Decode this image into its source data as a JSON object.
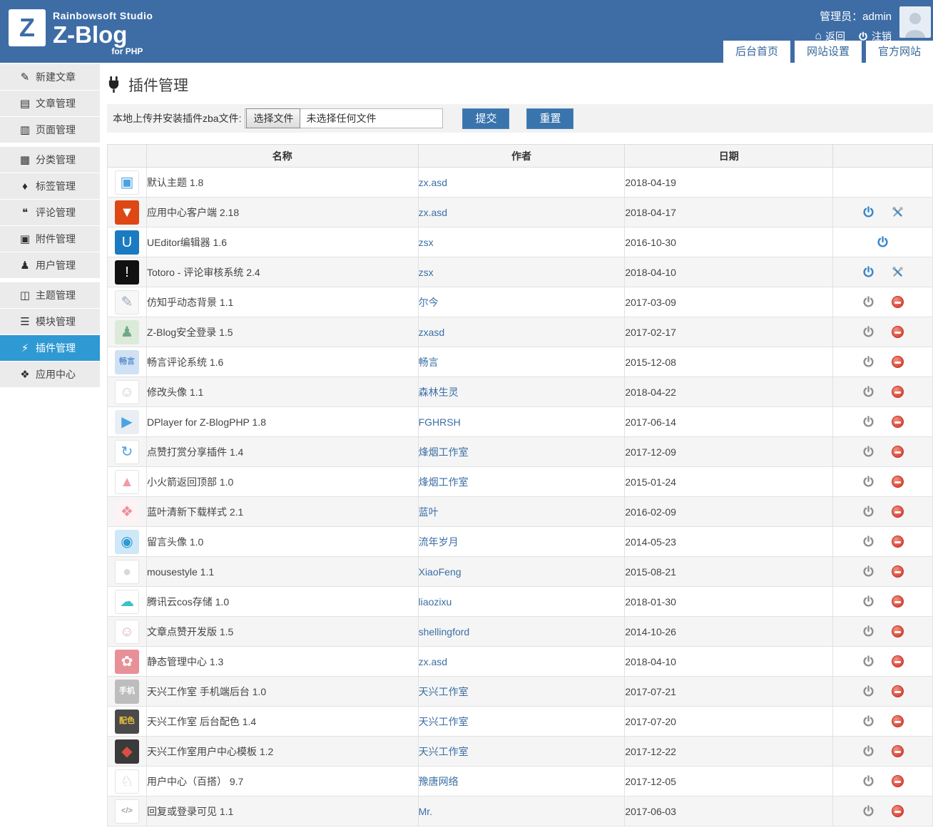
{
  "colors": {
    "header_bg": "#3e6da6",
    "active_sidebar_bg": "#2f99d3",
    "button_bg": "#3a74ad",
    "link": "#3a6ea5",
    "power_on": "#3a87c8",
    "power_off": "#8f8f8f",
    "disable_red": "#dd4b3e"
  },
  "header": {
    "brand": {
      "logo_letter": "Z",
      "studio": "Rainbowsoft Studio",
      "name": "Z-Blog",
      "sub": "for PHP"
    },
    "user": {
      "role_label": "管理员：",
      "username": "admin",
      "back": "返回",
      "logout": "注销"
    },
    "tabs": [
      {
        "label": "后台首页"
      },
      {
        "label": "网站设置"
      },
      {
        "label": "官方网站"
      }
    ]
  },
  "sidebar": {
    "groups": [
      {
        "items": [
          {
            "icon": "pencil",
            "glyph": "✎",
            "label": "新建文章",
            "active": false
          },
          {
            "icon": "document",
            "glyph": "▤",
            "label": "文章管理",
            "active": false
          },
          {
            "icon": "page",
            "glyph": "▥",
            "label": "页面管理",
            "active": false
          }
        ]
      },
      {
        "items": [
          {
            "icon": "folder",
            "glyph": "▦",
            "label": "分类管理",
            "active": false
          },
          {
            "icon": "tag",
            "glyph": "♦",
            "label": "标签管理",
            "active": false
          },
          {
            "icon": "comment",
            "glyph": "❝",
            "label": "评论管理",
            "active": false
          },
          {
            "icon": "attachment",
            "glyph": "▣",
            "label": "附件管理",
            "active": false
          },
          {
            "icon": "user",
            "glyph": "♟",
            "label": "用户管理",
            "active": false
          }
        ]
      },
      {
        "items": [
          {
            "icon": "theme",
            "glyph": "◫",
            "label": "主题管理",
            "active": false
          },
          {
            "icon": "module",
            "glyph": "☰",
            "label": "模块管理",
            "active": false
          },
          {
            "icon": "plugin",
            "glyph": "⚡",
            "label": "插件管理",
            "active": true
          },
          {
            "icon": "appcenter",
            "glyph": "❖",
            "label": "应用中心",
            "active": false
          }
        ]
      }
    ]
  },
  "main": {
    "title": "插件管理",
    "upload": {
      "label": "本地上传并安装插件zba文件:",
      "choose_file": "选择文件",
      "no_file": "未选择任何文件",
      "submit": "提交",
      "reset": "重置"
    },
    "table": {
      "headers": {
        "name": "名称",
        "author": "作者",
        "date": "日期"
      },
      "rows": [
        {
          "icon": {
            "glyph": "▣",
            "fg": "#4aa3e0",
            "bg": "#ffffff",
            "border": true
          },
          "name": "默认主题 1.8",
          "author": "zx.asd",
          "date": "2018-04-19",
          "actions": []
        },
        {
          "icon": {
            "glyph": "▼",
            "fg": "#ffffff",
            "bg": "#dd4814"
          },
          "name": "应用中心客户端 2.18",
          "author": "zx.asd",
          "date": "2018-04-17",
          "actions": [
            "power-on",
            "tools"
          ]
        },
        {
          "icon": {
            "glyph": "U",
            "fg": "#ffffff",
            "bg": "#1a7bc0"
          },
          "name": "UEditor编辑器 1.6",
          "author": "zsx",
          "date": "2016-10-30",
          "actions": [
            "power-on"
          ]
        },
        {
          "icon": {
            "glyph": "!",
            "fg": "#ffffff",
            "bg": "#111111"
          },
          "name": "Totoro - 评论审核系统 2.4",
          "author": "zsx",
          "date": "2018-04-10",
          "actions": [
            "power-on",
            "tools"
          ]
        },
        {
          "icon": {
            "glyph": "✎",
            "fg": "#9aa7b5",
            "bg": "#f7f7f7",
            "border": true
          },
          "name": "仿知乎动态背景 1.1",
          "author": "尔今",
          "date": "2017-03-09",
          "actions": [
            "power-off",
            "ban"
          ]
        },
        {
          "icon": {
            "glyph": "♟",
            "fg": "#6fa885",
            "bg": "#dcead9"
          },
          "name": "Z-Blog安全登录 1.5",
          "author": "zxasd",
          "date": "2017-02-17",
          "actions": [
            "power-off",
            "ban"
          ]
        },
        {
          "icon": {
            "glyph": "畅言",
            "fg": "#5b8fd0",
            "bg": "#cfe1f3",
            "small": true
          },
          "name": "畅言评论系统 1.6",
          "author": "畅言",
          "date": "2015-12-08",
          "actions": [
            "power-off",
            "ban"
          ]
        },
        {
          "icon": {
            "glyph": "☺",
            "fg": "#c9c9c9",
            "bg": "#ffffff",
            "border": true
          },
          "name": "修改头像 1.1",
          "author": "森林生灵",
          "date": "2018-04-22",
          "actions": [
            "power-off",
            "ban"
          ]
        },
        {
          "icon": {
            "glyph": "▶",
            "fg": "#4aa3e0",
            "bg": "#e9eef5"
          },
          "name": "DPlayer for Z-BlogPHP 1.8",
          "author": "FGHRSH",
          "date": "2017-06-14",
          "actions": [
            "power-off",
            "ban"
          ]
        },
        {
          "icon": {
            "glyph": "↻",
            "fg": "#4aa3e0",
            "bg": "#ffffff",
            "border": true
          },
          "name": "点赞打赏分享插件 1.4",
          "author": "烽烟工作室",
          "date": "2017-12-09",
          "actions": [
            "power-off",
            "ban"
          ]
        },
        {
          "icon": {
            "glyph": "▲",
            "fg": "#f29aa8",
            "bg": "#ffffff",
            "border": true
          },
          "name": "小火箭返回顶部 1.0",
          "author": "烽烟工作室",
          "date": "2015-01-24",
          "actions": [
            "power-off",
            "ban"
          ]
        },
        {
          "icon": {
            "glyph": "❖",
            "fg": "#ee8d9a",
            "bg": "#fdf3f4"
          },
          "name": "蓝叶清新下载样式 2.1",
          "author": "蓝叶",
          "date": "2016-02-09",
          "actions": [
            "power-off",
            "ban"
          ]
        },
        {
          "icon": {
            "glyph": "◉",
            "fg": "#2f99d3",
            "bg": "#cfe8f8"
          },
          "name": "留言头像 1.0",
          "author": "流年岁月",
          "date": "2014-05-23",
          "actions": [
            "power-off",
            "ban"
          ]
        },
        {
          "icon": {
            "glyph": "●",
            "fg": "#d9d9d9",
            "bg": "#ffffff",
            "border": true
          },
          "name": "mousestyle 1.1",
          "author": "XiaoFeng",
          "date": "2015-08-21",
          "actions": [
            "power-off",
            "ban"
          ]
        },
        {
          "icon": {
            "glyph": "☁",
            "fg": "#39c2c9",
            "bg": "#ffffff",
            "border": true
          },
          "name": "腾讯云cos存储 1.0",
          "author": "liaozixu",
          "date": "2018-01-30",
          "actions": [
            "power-off",
            "ban"
          ]
        },
        {
          "icon": {
            "glyph": "☺",
            "fg": "#d8b0b0",
            "bg": "#ffffff",
            "border": true
          },
          "name": "文章点赞开发版 1.5",
          "author": "shellingford",
          "date": "2014-10-26",
          "actions": [
            "power-off",
            "ban"
          ]
        },
        {
          "icon": {
            "glyph": "✿",
            "fg": "#ffffff",
            "bg": "#e89098"
          },
          "name": "静态管理中心 1.3",
          "author": "zx.asd",
          "date": "2018-04-10",
          "actions": [
            "power-off",
            "ban"
          ]
        },
        {
          "icon": {
            "glyph": "手机",
            "fg": "#ffffff",
            "bg": "#bdbdbd",
            "small": true
          },
          "name": "天兴工作室 手机端后台 1.0",
          "author": "天兴工作室",
          "date": "2017-07-21",
          "actions": [
            "power-off",
            "ban"
          ]
        },
        {
          "icon": {
            "glyph": "配色",
            "fg": "#e8c33a",
            "bg": "#4a4a4a",
            "small": true
          },
          "name": "天兴工作室 后台配色 1.4",
          "author": "天兴工作室",
          "date": "2017-07-20",
          "actions": [
            "power-off",
            "ban"
          ]
        },
        {
          "icon": {
            "glyph": "◆",
            "fg": "#d94f43",
            "bg": "#3a3a3a"
          },
          "name": "天兴工作室用户中心模板 1.2",
          "author": "天兴工作室",
          "date": "2017-12-22",
          "actions": [
            "power-off",
            "ban"
          ]
        },
        {
          "icon": {
            "glyph": "♘",
            "fg": "#c6c6c6",
            "bg": "#ffffff",
            "border": true
          },
          "name": "用户中心（百搭） 9.7",
          "author": "豫唐网络",
          "date": "2017-12-05",
          "actions": [
            "power-off",
            "ban"
          ]
        },
        {
          "icon": {
            "glyph": "</>",
            "fg": "#9f9f9f",
            "bg": "#ffffff",
            "border": true,
            "small": true
          },
          "name": "回复或登录可见 1.1",
          "author": "Mr.",
          "date": "2017-06-03",
          "actions": [
            "power-off",
            "ban"
          ]
        }
      ]
    }
  }
}
